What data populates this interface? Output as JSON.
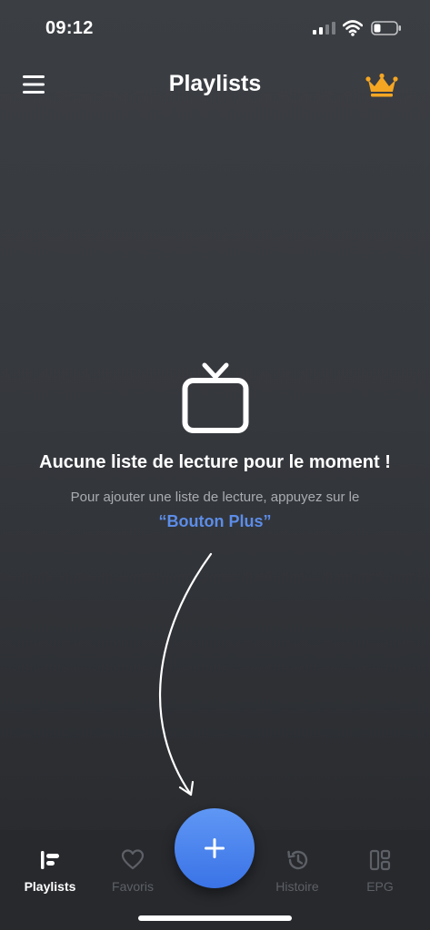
{
  "status_bar": {
    "time": "09:12",
    "icons": [
      "cellular-signal-icon",
      "wifi-icon",
      "battery-icon"
    ]
  },
  "header": {
    "title": "Playlists",
    "menu_icon": "hamburger-menu-icon",
    "premium_icon": "crown-icon",
    "premium_color": "#f4a623"
  },
  "empty_state": {
    "icon": "tv-icon",
    "title": "Aucune liste de lecture pour le moment !",
    "subtitle": "Pour ajouter une liste de lecture, appuyez sur le",
    "link": "“Bouton Plus”",
    "link_color": "#5c8de8"
  },
  "fab": {
    "icon": "plus-icon",
    "color": "#4a84ee"
  },
  "tab_bar": {
    "tabs": [
      {
        "label": "Playlists",
        "icon": "playlists-icon",
        "active": true
      },
      {
        "label": "Favoris",
        "icon": "heart-icon",
        "active": false
      },
      {
        "label": "Histoire",
        "icon": "history-icon",
        "active": false
      },
      {
        "label": "EPG",
        "icon": "epg-grid-icon",
        "active": false
      }
    ]
  }
}
